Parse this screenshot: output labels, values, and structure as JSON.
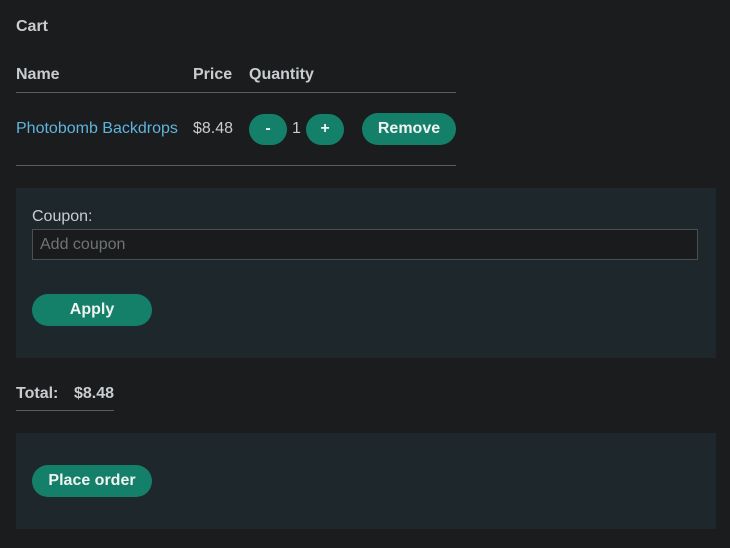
{
  "cart": {
    "title": "Cart",
    "columns": {
      "name": "Name",
      "price": "Price",
      "quantity": "Quantity"
    },
    "items": [
      {
        "name": "Photobomb Backdrops",
        "price": "$8.48",
        "quantity": "1",
        "decrement_label": "-",
        "increment_label": "+",
        "remove_label": "Remove"
      }
    ]
  },
  "coupon": {
    "label": "Coupon:",
    "placeholder": "Add coupon",
    "value": "",
    "apply_label": "Apply"
  },
  "total": {
    "label": "Total:",
    "value": "$8.48"
  },
  "order": {
    "place_label": "Place order"
  },
  "colors": {
    "background": "#1b1c1d",
    "panel": "#1d272c",
    "accent": "#14806a",
    "link": "#5fb4de"
  }
}
